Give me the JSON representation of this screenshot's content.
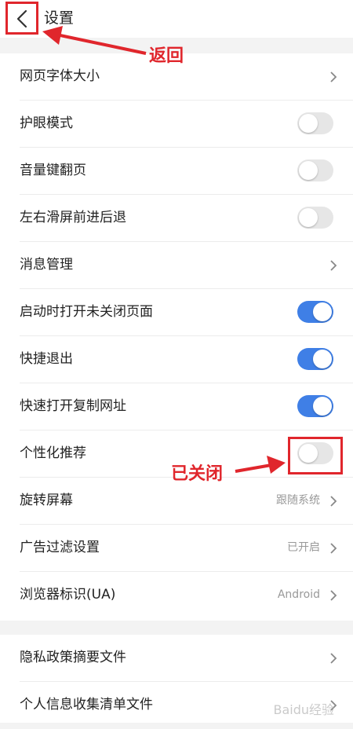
{
  "header": {
    "title": "设置"
  },
  "settings": [
    {
      "label": "网页字体大小",
      "type": "nav"
    },
    {
      "label": "护眼模式",
      "type": "toggle",
      "on": false
    },
    {
      "label": "音量键翻页",
      "type": "toggle",
      "on": false
    },
    {
      "label": "左右滑屏前进后退",
      "type": "toggle",
      "on": false
    },
    {
      "label": "消息管理",
      "type": "nav"
    },
    {
      "label": "启动时打开未关闭页面",
      "type": "toggle",
      "on": true
    },
    {
      "label": "快捷退出",
      "type": "toggle",
      "on": true
    },
    {
      "label": "快速打开复制网址",
      "type": "toggle",
      "on": true
    },
    {
      "label": "个性化推荐",
      "type": "toggle",
      "on": false
    },
    {
      "label": "旋转屏幕",
      "type": "nav",
      "value": "跟随系统"
    },
    {
      "label": "广告过滤设置",
      "type": "nav",
      "value": "已开启"
    },
    {
      "label": "浏览器标识(UA)",
      "type": "nav",
      "value": "Android"
    }
  ],
  "privacy": [
    {
      "label": "隐私政策摘要文件"
    },
    {
      "label": "个人信息收集清单文件"
    }
  ],
  "annotations": {
    "back_label": "返回",
    "closed_label": "已关闭",
    "color": "#e0262c"
  },
  "watermark": "Baidu经验"
}
